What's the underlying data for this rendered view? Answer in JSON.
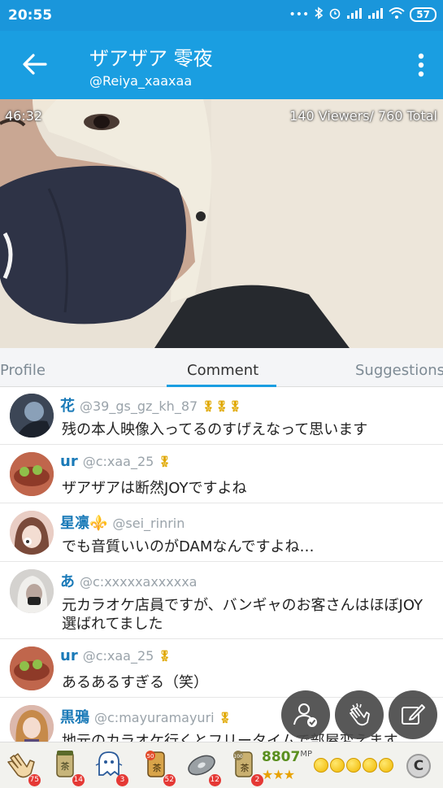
{
  "status_bar": {
    "time": "20:55",
    "battery": "57",
    "icons": [
      "dots-icon",
      "bluetooth-icon",
      "alarm-icon",
      "signal-icon",
      "signal-icon",
      "wifi-icon",
      "battery-icon"
    ]
  },
  "header": {
    "title": "ザアザア 零夜",
    "handle": "@Reiya_xaaxaa"
  },
  "video": {
    "elapsed": "46:32",
    "viewers": "140 Viewers/ 760 Total"
  },
  "tabs": [
    {
      "label": "Profile",
      "active": false
    },
    {
      "label": "Comment",
      "active": true
    },
    {
      "label": "Suggestions",
      "active": false
    }
  ],
  "comments": [
    {
      "name": "花",
      "handle": "@39_gs_gz_kh_87",
      "badge": "medal-icon",
      "text": "残の本人映像入ってるのすげえなって思います"
    },
    {
      "name": "ur",
      "handle": "@c:xaa_25",
      "badge": "medal-icon",
      "text": "ザアザアは断然JOYですよね"
    },
    {
      "name": "星凛⚜️",
      "handle": "@sei_rinrin",
      "badge": "",
      "text": "でも音質いいのがDAMなんですよね…"
    },
    {
      "name": "あ",
      "handle": "@c:xxxxxaxxxxxa",
      "badge": "",
      "text": "元カラオケ店員ですが、バンギャのお客さんはほぼJOY選ばれてました"
    },
    {
      "name": "ur",
      "handle": "@c:xaa_25",
      "badge": "medal-icon",
      "text": "あるあるすぎる（笑）"
    },
    {
      "name": "黒鴉",
      "handle": "@c:mayuramayuri",
      "badge": "medal-icon",
      "text": "地元のカラオケ行くとフリータイムで部屋変えます"
    }
  ],
  "action_buttons": [
    "user-check-icon",
    "clap-icon",
    "edit-icon"
  ],
  "gifts": [
    {
      "icon": "clap-gift-icon",
      "count": "75"
    },
    {
      "icon": "tea-gift-icon",
      "count": "14"
    },
    {
      "icon": "ghost-gift-icon",
      "count": "3"
    },
    {
      "icon": "tea-50-gift-icon",
      "count": "52"
    },
    {
      "icon": "disc-gift-icon",
      "count": "12"
    },
    {
      "icon": "tea-100-gift-icon",
      "count": "2"
    }
  ],
  "mp": {
    "value": "8807",
    "unit": "MP",
    "stars": "★★★"
  },
  "coins_count": 5,
  "c_button": "C"
}
